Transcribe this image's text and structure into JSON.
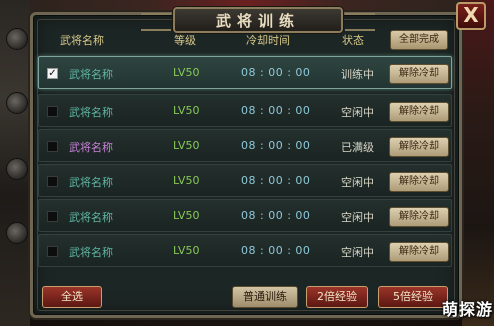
{
  "window": {
    "title": "武将训练",
    "close_label": "X"
  },
  "header": {
    "col_name": "武将名称",
    "col_level": "等级",
    "col_cooldown": "冷却时间",
    "col_status": "状态",
    "all_done_label": "全部完成"
  },
  "rows": [
    {
      "checked": true,
      "name": "武将名称",
      "name_color": "teal",
      "level": "LV50",
      "cooldown": "08 : 00 : 00",
      "status": "训练中",
      "action": "解除冷却"
    },
    {
      "checked": false,
      "name": "武将名称",
      "name_color": "teal",
      "level": "LV50",
      "cooldown": "08 : 00 : 00",
      "status": "空闲中",
      "action": "解除冷却"
    },
    {
      "checked": false,
      "name": "武将名称",
      "name_color": "purple",
      "level": "LV50",
      "cooldown": "08 : 00 : 00",
      "status": "已满级",
      "action": "解除冷却"
    },
    {
      "checked": false,
      "name": "武将名称",
      "name_color": "teal",
      "level": "LV50",
      "cooldown": "08 : 00 : 00",
      "status": "空闲中",
      "action": "解除冷却"
    },
    {
      "checked": false,
      "name": "武将名称",
      "name_color": "teal",
      "level": "LV50",
      "cooldown": "08 : 00 : 00",
      "status": "空闲中",
      "action": "解除冷却"
    },
    {
      "checked": false,
      "name": "武将名称",
      "name_color": "teal",
      "level": "LV50",
      "cooldown": "08 : 00 : 00",
      "status": "空闲中",
      "action": "解除冷却"
    }
  ],
  "footer": {
    "select_all": "全选",
    "normal_train": "普通训练",
    "double_exp": "2倍经验",
    "five_exp": "5倍经验"
  },
  "watermark": "萌探游",
  "colors": {
    "name_teal": "#5fb6a4",
    "name_purple": "#c880d8",
    "level_green": "#88c858",
    "header_gold": "#d9c98a"
  }
}
